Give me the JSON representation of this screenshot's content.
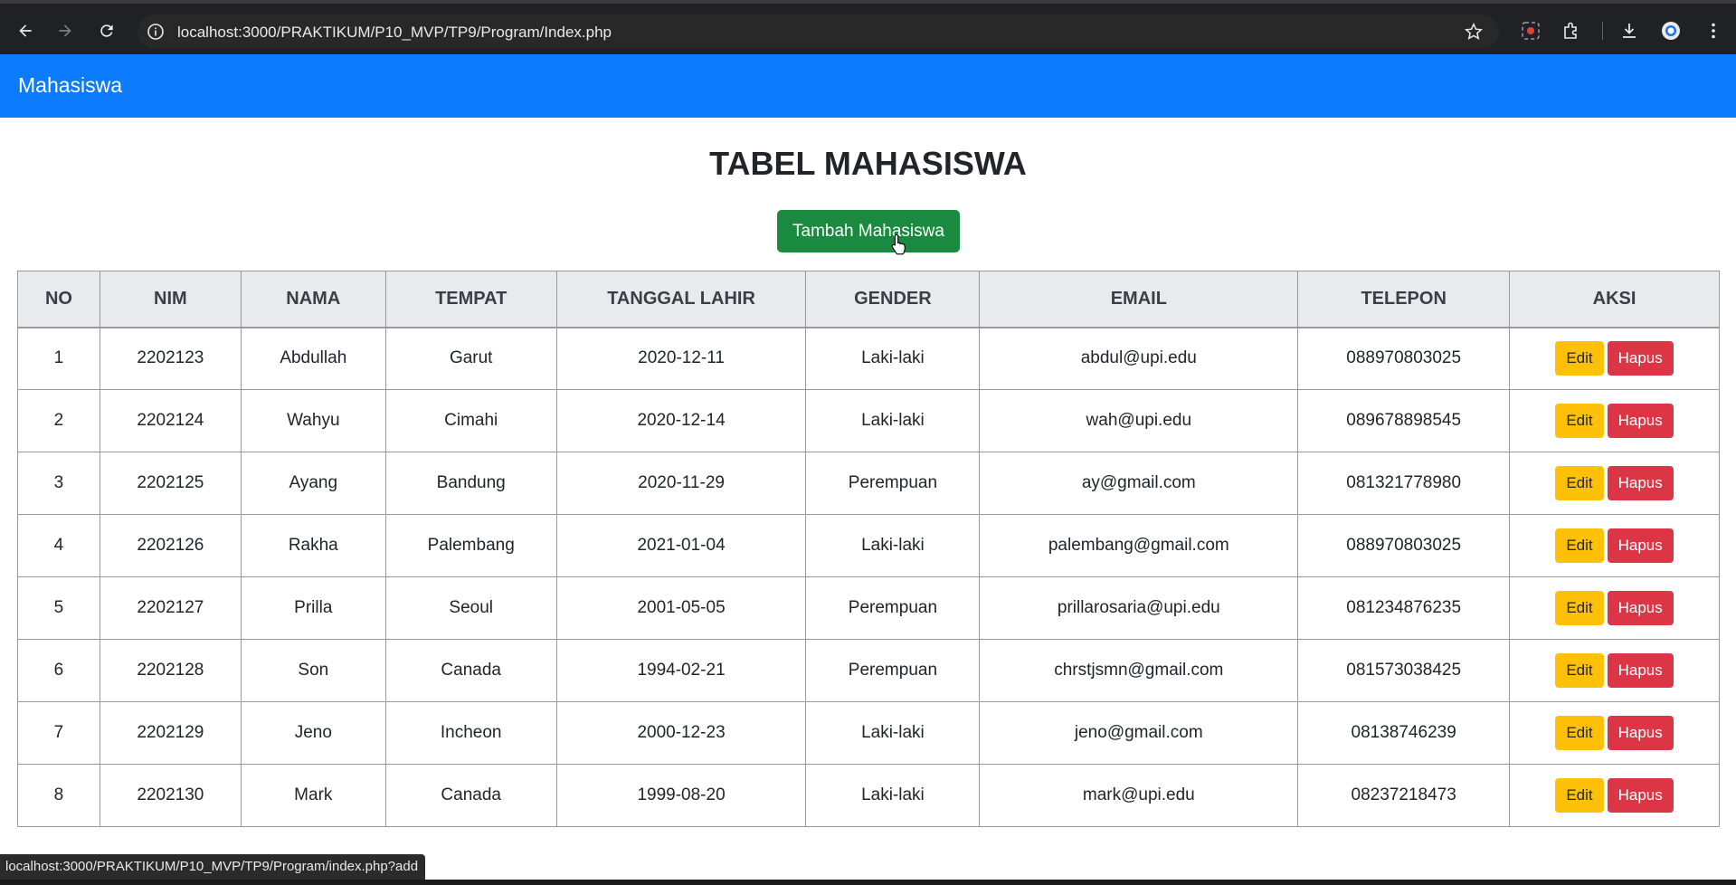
{
  "browser": {
    "url": "localhost:3000/PRAKTIKUM/P10_MVP/TP9/Program/Index.php",
    "status_url": "localhost:3000/PRAKTIKUM/P10_MVP/TP9/Program/index.php?add"
  },
  "navbar": {
    "brand": "Mahasiswa"
  },
  "main": {
    "title": "TABEL MAHASISWA",
    "add_button": "Tambah Mahasiswa"
  },
  "table": {
    "headers": [
      "NO",
      "NIM",
      "NAMA",
      "TEMPAT",
      "TANGGAL LAHIR",
      "GENDER",
      "EMAIL",
      "TELEPON",
      "AKSI"
    ],
    "edit_label": "Edit",
    "delete_label": "Hapus",
    "rows": [
      [
        "1",
        "2202123",
        "Abdullah",
        "Garut",
        "2020-12-11",
        "Laki-laki",
        "abdul@upi.edu",
        "088970803025"
      ],
      [
        "2",
        "2202124",
        "Wahyu",
        "Cimahi",
        "2020-12-14",
        "Laki-laki",
        "wah@upi.edu",
        "089678898545"
      ],
      [
        "3",
        "2202125",
        "Ayang",
        "Bandung",
        "2020-11-29",
        "Perempuan",
        "ay@gmail.com",
        "081321778980"
      ],
      [
        "4",
        "2202126",
        "Rakha",
        "Palembang",
        "2021-01-04",
        "Laki-laki",
        "palembang@gmail.com",
        "088970803025"
      ],
      [
        "5",
        "2202127",
        "Prilla",
        "Seoul",
        "2001-05-05",
        "Perempuan",
        "prillarosaria@upi.edu",
        "081234876235"
      ],
      [
        "6",
        "2202128",
        "Son",
        "Canada",
        "1994-02-21",
        "Perempuan",
        "chrstjsmn@gmail.com",
        "081573038425"
      ],
      [
        "7",
        "2202129",
        "Jeno",
        "Incheon",
        "2000-12-23",
        "Laki-laki",
        "jeno@gmail.com",
        "08138746239"
      ],
      [
        "8",
        "2202130",
        "Mark",
        "Canada",
        "1999-08-20",
        "Laki-laki",
        "mark@upi.edu",
        "08237218473"
      ]
    ]
  },
  "colors": {
    "navbar": "#0d7bfd",
    "add_button": "#198a3f",
    "edit_button": "#ffc107",
    "delete_button": "#dc3545"
  }
}
